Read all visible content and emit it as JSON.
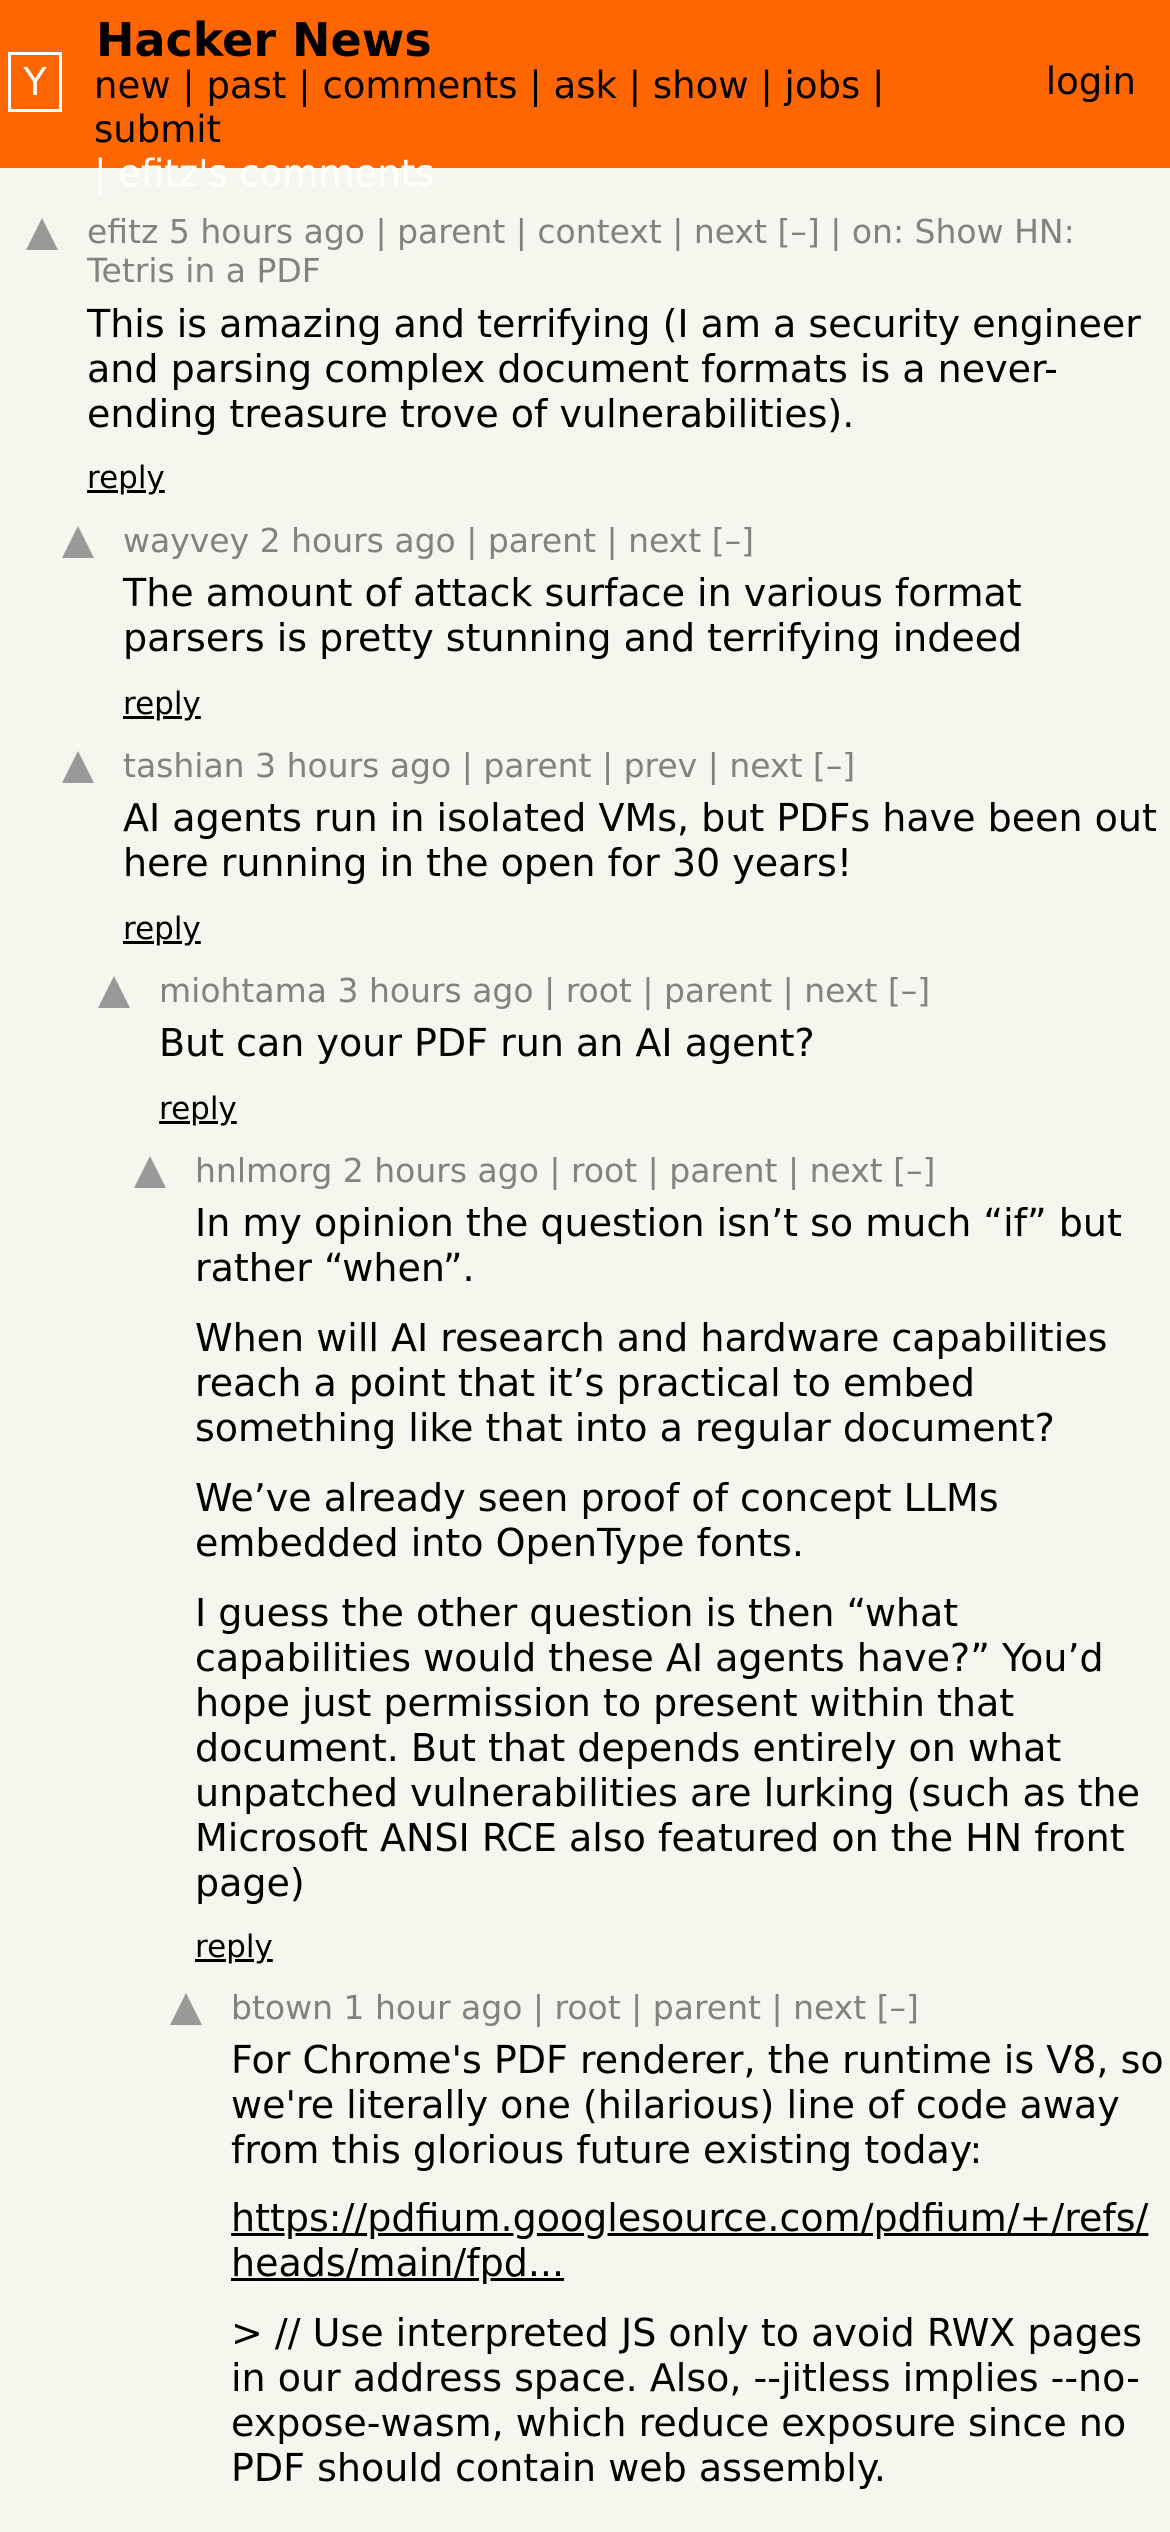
{
  "header": {
    "logo_letter": "Y",
    "title": "Hacker News",
    "nav": [
      "new",
      "past",
      "comments",
      "ask",
      "show",
      "jobs",
      "submit"
    ],
    "current_user_link": "efitz's comments",
    "login": "login"
  },
  "comments": [
    {
      "user": "efitz",
      "age": "5 hours ago",
      "links": [
        "parent",
        "context",
        "next [–]"
      ],
      "story": "on: Show HN: Tetris in a PDF",
      "paragraphs": [
        "This is amazing and terrifying (I am a security engineer and parsing complex document formats is a never-ending treasure trove of vulnerabilities)."
      ],
      "reply": "reply"
    },
    {
      "user": "wayvey",
      "age": "2 hours ago",
      "links": [
        "parent",
        "next [–]"
      ],
      "paragraphs": [
        "The amount of attack surface in various format parsers is pretty stunning and terrifying indeed"
      ],
      "reply": "reply"
    },
    {
      "user": "tashian",
      "age": "3 hours ago",
      "links": [
        "parent",
        "prev",
        "next [–]"
      ],
      "paragraphs": [
        "AI agents run in isolated VMs, but PDFs have been out here running in the open for 30 years!"
      ],
      "reply": "reply"
    },
    {
      "user": "miohtama",
      "age": "3 hours ago",
      "links": [
        "root",
        "parent",
        "next [–]"
      ],
      "paragraphs": [
        "But can your PDF run an AI agent?"
      ],
      "reply": "reply"
    },
    {
      "user": "hnlmorg",
      "age": "2 hours ago",
      "links": [
        "root",
        "parent",
        "next [–]"
      ],
      "paragraphs": [
        "In my opinion the question isn’t so much “if” but rather “when”.",
        "When will AI research and hardware capabilities reach a point that it’s practical to embed something like that into a regular document?",
        "We’ve already seen proof of concept LLMs embedded into OpenType fonts.",
        "I guess the other question is then “what capabilities would these AI agents have?” You’d hope just permission to present within that document. But that depends entirely on what unpatched vulnerabilities are lurking (such as the Microsoft ANSI RCE also featured on the HN front page)"
      ],
      "reply": "reply"
    },
    {
      "user": "btown",
      "age": "1 hour ago",
      "links": [
        "root",
        "parent",
        "next [–]"
      ],
      "paragraphs": [
        "For Chrome's PDF renderer, the runtime is V8, so we're literally one (hilarious) line of code away from this glorious future existing today:",
        "https://pdfium.googlesource.com/pdfium/+/refs/heads/main/fpd...",
        "> // Use interpreted JS only to avoid RWX pages in our address space. Also, --jitless implies --no-expose-wasm, which reduce exposure since no PDF should contain web assembly."
      ]
    }
  ]
}
